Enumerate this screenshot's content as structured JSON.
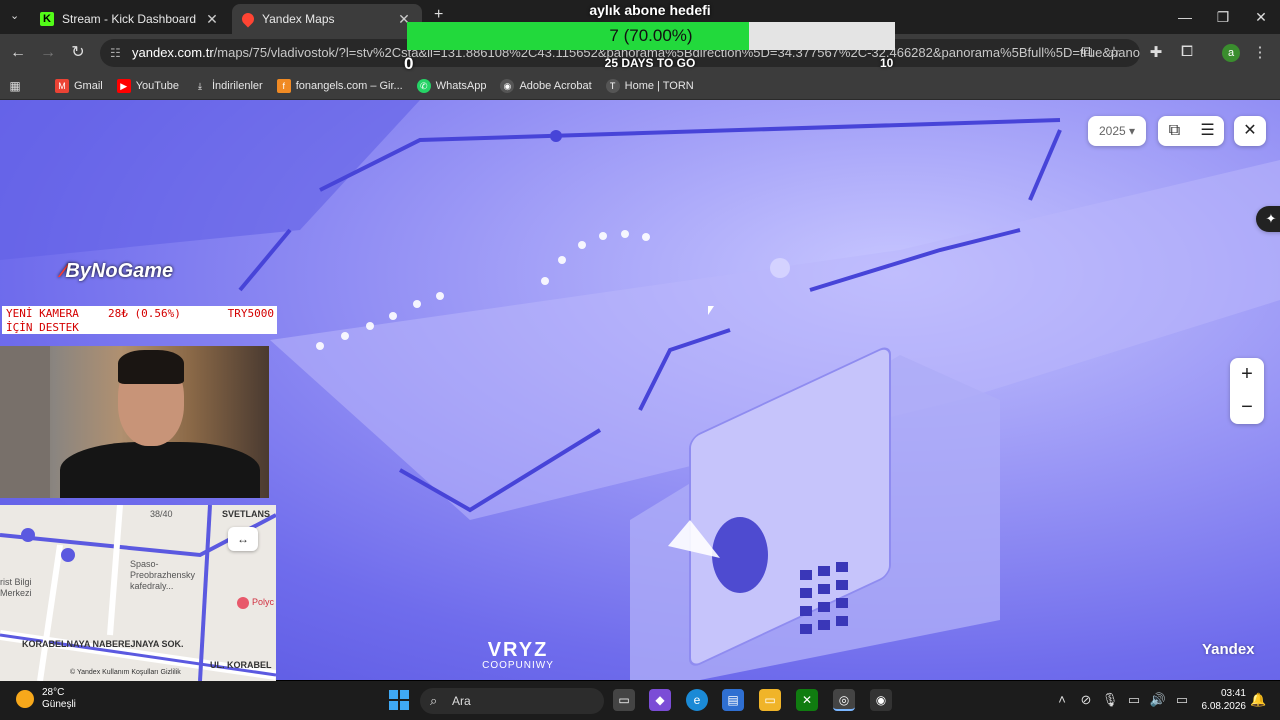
{
  "browser": {
    "tabs": [
      {
        "title": "Stream - Kick Dashboard",
        "icon": "kick-icon"
      },
      {
        "title": "Yandex Maps",
        "icon": "map-pin-icon",
        "active": true
      }
    ],
    "url_host": "yandex.com.tr",
    "url_path": "/maps/75/vladivostok/?l=stv%2Csta&ll=131.886108%2C43.115652&panorama%5Bdirection%5D=34.377567%2C-32.466282&panorama%5Bfull%5D=true&panorama...",
    "profile_initial": "a",
    "bookmarks": [
      {
        "label": "Gmail",
        "icon": "gmail-icon",
        "color": "#ea4335"
      },
      {
        "label": "YouTube",
        "icon": "youtube-icon",
        "color": "#ff0000"
      },
      {
        "label": "İndirilenler",
        "icon": "download-icon",
        "color": "#3c3c3c"
      },
      {
        "label": "fonangels.com – Gir...",
        "icon": "fonangels-icon",
        "color": "#f08a24"
      },
      {
        "label": "WhatsApp",
        "icon": "whatsapp-icon",
        "color": "#25d366"
      },
      {
        "label": "Adobe Acrobat",
        "icon": "acrobat-icon",
        "color": "#555555"
      },
      {
        "label": "Home | TORN",
        "icon": "torn-icon",
        "color": "#555555"
      }
    ]
  },
  "goal": {
    "title": "aylık abone hedefi",
    "progress_text": "7 (70.00%)",
    "progress_fraction": 0.7,
    "start": "0",
    "days_left": "25 DAYS TO GO",
    "end": "10"
  },
  "panorama": {
    "year": "2025",
    "brand": "Yandex",
    "accent": "#6f6cec"
  },
  "overlay": {
    "brand": "ByNoGame",
    "donation_line1": "YENİ KAMERA",
    "donation_pct": "28₺ (0.56%)",
    "donation_goal": "TRY5000",
    "donation_line2": "İÇİN DESTEK",
    "watermark_big": "VRYZ",
    "watermark_small": "COOPUNIWY"
  },
  "minimap": {
    "counter": "38/40",
    "street_1": "SVETLANS",
    "street_2": "KORABELNAYA NABEREJNAYA SOK.",
    "street_3": "UL. KORABEL",
    "poi_1": "Spaso-",
    "poi_2": "Preobrazhensky",
    "poi_3": "kafedraly...",
    "poi_4": "Polyc",
    "poi_5a": "rist Bilgi",
    "poi_5b": "Merkezi",
    "legal": "© Yandex   Kullanım Koşulları   Gizlilik"
  },
  "taskbar": {
    "temp": "28°C",
    "weather": "Güneşli",
    "search": "Ara",
    "time": "03:41",
    "date": "6.08.2026"
  }
}
